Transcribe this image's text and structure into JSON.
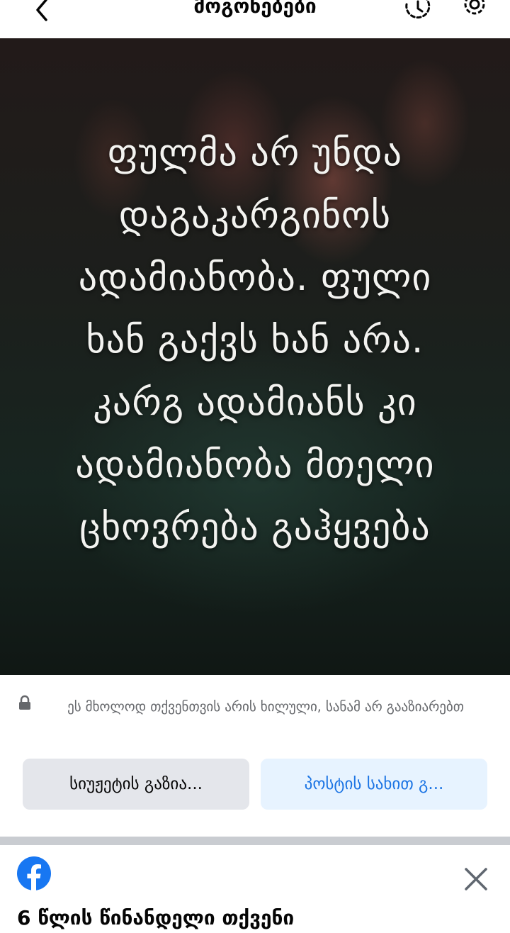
{
  "header": {
    "title": "მოგონებები",
    "back_icon": "chevron-left-icon",
    "history_icon": "history-icon",
    "settings_icon": "gear-icon"
  },
  "memory": {
    "quote": "ფულმა არ უნდა\nდაგაკარგინოს\nადამიანობა. ფული\nხან გაქვს ხან არა.\nკარგ ადამიანს კი\nადამიანობა მთელი\nცხოვრება გაჰყვება"
  },
  "privacy": {
    "note": "ეს მხოლოდ თქვენთვის არის ხილული, სანამ არ გააზიარებთ",
    "lock_icon": "lock-icon"
  },
  "actions": {
    "story_label": "სიუჟეტის გაზია...",
    "post_label": "პოსტის სახით გ..."
  },
  "next_memory": {
    "title": "6 წლის წინანდელი თქვენი",
    "app_icon": "facebook-icon",
    "close_icon": "close-icon"
  },
  "colors": {
    "accent": "#1b74e4",
    "facebook_blue": "#1877f2",
    "secondary_text": "#65676b",
    "grey_button": "#e4e6eb",
    "blue_button": "#e7f3ff"
  }
}
